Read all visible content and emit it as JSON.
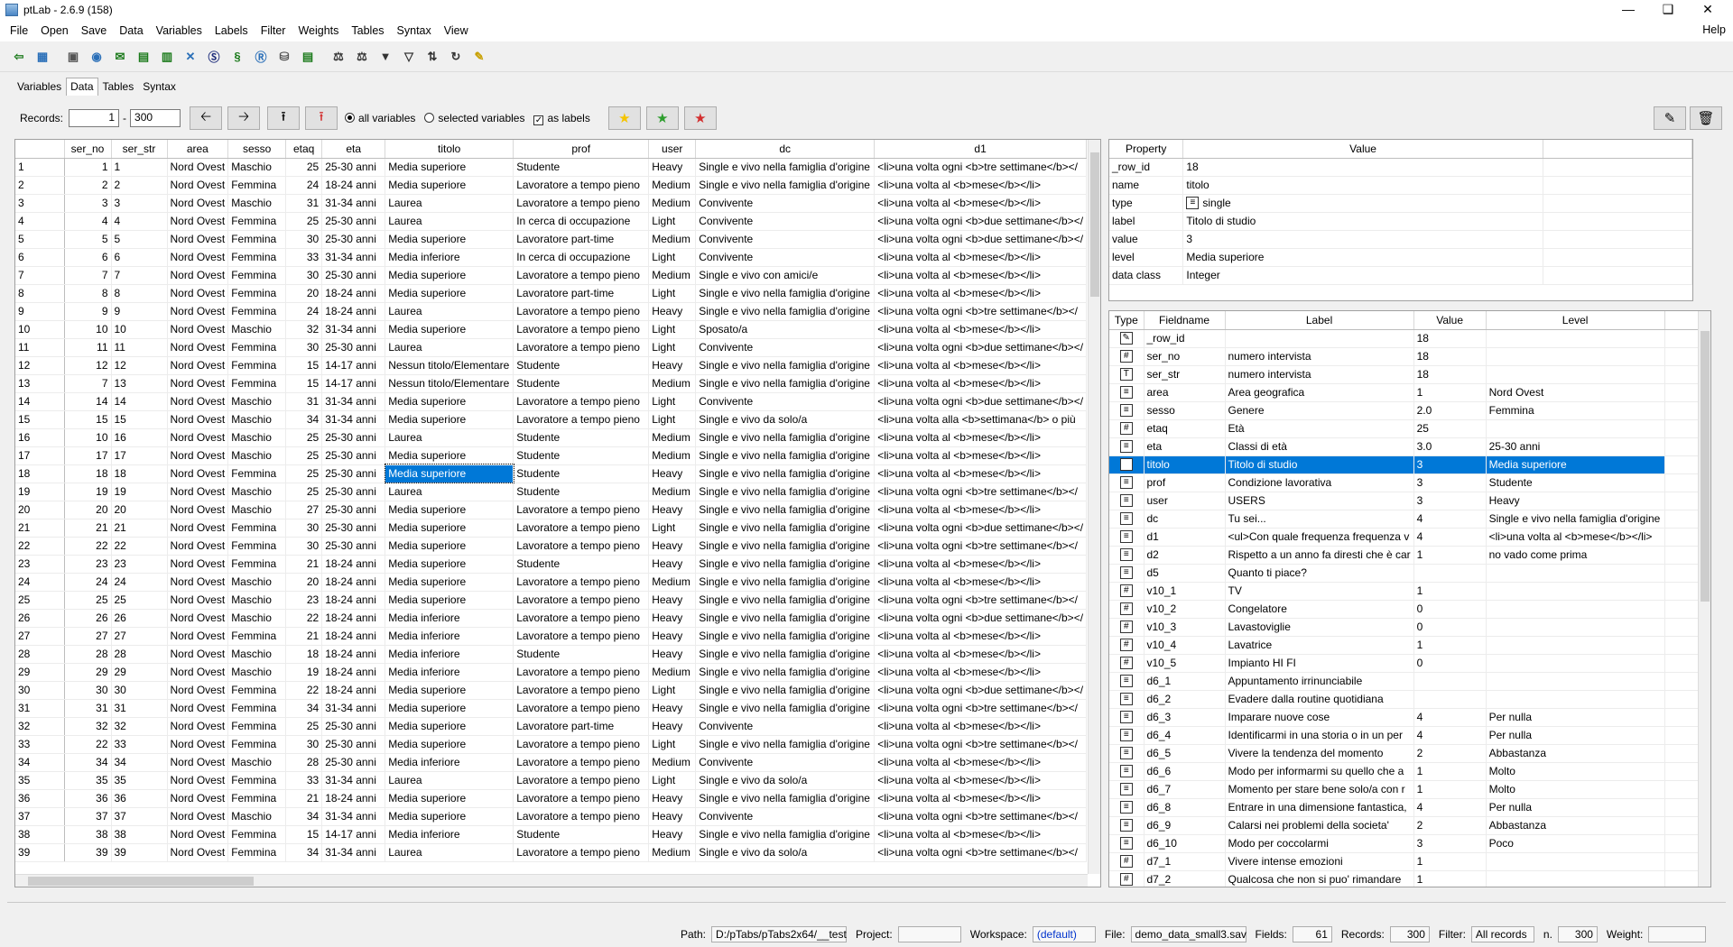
{
  "window": {
    "title": "ptLab - 2.6.9 (158)"
  },
  "menu": [
    "File",
    "Open",
    "Save",
    "Data",
    "Variables",
    "Labels",
    "Filter",
    "Weights",
    "Tables",
    "Syntax",
    "View"
  ],
  "menu_help": "Help",
  "tabs": [
    "Variables",
    "Data",
    "Tables",
    "Syntax"
  ],
  "records": {
    "label": "Records:",
    "from": "1",
    "dash": "-",
    "to": "300"
  },
  "options": {
    "all_variables": "all variables",
    "selected_variables": "selected variables",
    "as_labels": "as labels"
  },
  "toolbar_icons": [
    "exit-icon",
    "grid-icon",
    "layout-icon",
    "globe-icon",
    "spss-icon",
    "excel-icon",
    "csv-icon",
    "sas-icon",
    "stata-icon",
    "s-icon",
    "r-icon",
    "database-icon",
    "export-icon",
    "weight-icon",
    "weight2-icon",
    "filter-icon",
    "filter-clear-icon",
    "sort-icon",
    "refresh-icon",
    "key-icon"
  ],
  "data_columns": [
    "ser_no",
    "ser_str",
    "area",
    "sesso",
    "etaq",
    "eta",
    "titolo",
    "prof",
    "user",
    "dc",
    "d1"
  ],
  "data_rows": [
    [
      "1",
      "1",
      "1",
      "Nord Ovest",
      "Maschio",
      "25",
      "25-30 anni",
      "Media superiore",
      "Studente",
      "Heavy",
      "Single e vivo nella famiglia d'origine",
      "<li>una volta ogni <b>tre settimane</b></"
    ],
    [
      "2",
      "2",
      "2",
      "Nord Ovest",
      "Femmina",
      "24",
      "18-24 anni",
      "Media superiore",
      "Lavoratore a tempo pieno",
      "Medium",
      "Single e vivo nella famiglia d'origine",
      "<li>una volta al <b>mese</b></li>"
    ],
    [
      "3",
      "3",
      "3",
      "Nord Ovest",
      "Maschio",
      "31",
      "31-34 anni",
      "Laurea",
      "Lavoratore a tempo pieno",
      "Medium",
      "Convivente",
      "<li>una volta al <b>mese</b></li>"
    ],
    [
      "4",
      "4",
      "4",
      "Nord Ovest",
      "Femmina",
      "25",
      "25-30 anni",
      "Laurea",
      "In cerca di occupazione",
      "Light",
      "Convivente",
      "<li>una volta ogni <b>due settimane</b></"
    ],
    [
      "5",
      "5",
      "5",
      "Nord Ovest",
      "Femmina",
      "30",
      "25-30 anni",
      "Media superiore",
      "Lavoratore part-time",
      "Medium",
      "Convivente",
      "<li>una volta ogni <b>due settimane</b></"
    ],
    [
      "6",
      "6",
      "6",
      "Nord Ovest",
      "Femmina",
      "33",
      "31-34 anni",
      "Media inferiore",
      "In cerca di occupazione",
      "Light",
      "Convivente",
      "<li>una volta al <b>mese</b></li>"
    ],
    [
      "7",
      "7",
      "7",
      "Nord Ovest",
      "Femmina",
      "30",
      "25-30 anni",
      "Media superiore",
      "Lavoratore a tempo pieno",
      "Medium",
      "Single e vivo con amici/e",
      "<li>una volta al <b>mese</b></li>"
    ],
    [
      "8",
      "8",
      "8",
      "Nord Ovest",
      "Femmina",
      "20",
      "18-24 anni",
      "Media superiore",
      "Lavoratore part-time",
      "Light",
      "Single e vivo nella famiglia d'origine",
      "<li>una volta al <b>mese</b></li>"
    ],
    [
      "9",
      "9",
      "9",
      "Nord Ovest",
      "Femmina",
      "24",
      "18-24 anni",
      "Laurea",
      "Lavoratore a tempo pieno",
      "Heavy",
      "Single e vivo nella famiglia d'origine",
      "<li>una volta ogni <b>tre settimane</b></"
    ],
    [
      "10",
      "10",
      "10",
      "Nord Ovest",
      "Maschio",
      "32",
      "31-34 anni",
      "Media superiore",
      "Lavoratore a tempo pieno",
      "Light",
      "Sposato/a",
      "<li>una volta al <b>mese</b></li>"
    ],
    [
      "11",
      "11",
      "11",
      "Nord Ovest",
      "Femmina",
      "30",
      "25-30 anni",
      "Laurea",
      "Lavoratore a tempo pieno",
      "Light",
      "Convivente",
      "<li>una volta ogni <b>due settimane</b></"
    ],
    [
      "12",
      "12",
      "12",
      "Nord Ovest",
      "Femmina",
      "15",
      "14-17 anni",
      "Nessun titolo/Elementare",
      "Studente",
      "Heavy",
      "Single e vivo nella famiglia d'origine",
      "<li>una volta al <b>mese</b></li>"
    ],
    [
      "13",
      "7",
      "13",
      "Nord Ovest",
      "Femmina",
      "15",
      "14-17 anni",
      "Nessun titolo/Elementare",
      "Studente",
      "Medium",
      "Single e vivo nella famiglia d'origine",
      "<li>una volta al <b>mese</b></li>"
    ],
    [
      "14",
      "14",
      "14",
      "Nord Ovest",
      "Maschio",
      "31",
      "31-34 anni",
      "Media superiore",
      "Lavoratore a tempo pieno",
      "Light",
      "Convivente",
      "<li>una volta ogni <b>due settimane</b></"
    ],
    [
      "15",
      "15",
      "15",
      "Nord Ovest",
      "Maschio",
      "34",
      "31-34 anni",
      "Media superiore",
      "Lavoratore a tempo pieno",
      "Light",
      "Single e vivo da solo/a",
      "<li>una volta alla <b>settimana</b> o più"
    ],
    [
      "16",
      "10",
      "16",
      "Nord Ovest",
      "Maschio",
      "25",
      "25-30 anni",
      "Laurea",
      "Studente",
      "Medium",
      "Single e vivo nella famiglia d'origine",
      "<li>una volta al <b>mese</b></li>"
    ],
    [
      "17",
      "17",
      "17",
      "Nord Ovest",
      "Maschio",
      "25",
      "25-30 anni",
      "Media superiore",
      "Studente",
      "Medium",
      "Single e vivo nella famiglia d'origine",
      "<li>una volta al <b>mese</b></li>"
    ],
    [
      "18",
      "18",
      "18",
      "Nord Ovest",
      "Femmina",
      "25",
      "25-30 anni",
      "Media superiore",
      "Studente",
      "Heavy",
      "Single e vivo nella famiglia d'origine",
      "<li>una volta al <b>mese</b></li>"
    ],
    [
      "19",
      "19",
      "19",
      "Nord Ovest",
      "Maschio",
      "25",
      "25-30 anni",
      "Laurea",
      "Studente",
      "Medium",
      "Single e vivo nella famiglia d'origine",
      "<li>una volta ogni <b>tre settimane</b></"
    ],
    [
      "20",
      "20",
      "20",
      "Nord Ovest",
      "Maschio",
      "27",
      "25-30 anni",
      "Media superiore",
      "Lavoratore a tempo pieno",
      "Heavy",
      "Single e vivo nella famiglia d'origine",
      "<li>una volta al <b>mese</b></li>"
    ],
    [
      "21",
      "21",
      "21",
      "Nord Ovest",
      "Femmina",
      "30",
      "25-30 anni",
      "Media superiore",
      "Lavoratore a tempo pieno",
      "Light",
      "Single e vivo nella famiglia d'origine",
      "<li>una volta ogni <b>due settimane</b></"
    ],
    [
      "22",
      "22",
      "22",
      "Nord Ovest",
      "Femmina",
      "30",
      "25-30 anni",
      "Media superiore",
      "Lavoratore a tempo pieno",
      "Heavy",
      "Single e vivo nella famiglia d'origine",
      "<li>una volta ogni <b>tre settimane</b></"
    ],
    [
      "23",
      "23",
      "23",
      "Nord Ovest",
      "Femmina",
      "21",
      "18-24 anni",
      "Media superiore",
      "Studente",
      "Heavy",
      "Single e vivo nella famiglia d'origine",
      "<li>una volta al <b>mese</b></li>"
    ],
    [
      "24",
      "24",
      "24",
      "Nord Ovest",
      "Maschio",
      "20",
      "18-24 anni",
      "Media superiore",
      "Lavoratore a tempo pieno",
      "Medium",
      "Single e vivo nella famiglia d'origine",
      "<li>una volta al <b>mese</b></li>"
    ],
    [
      "25",
      "25",
      "25",
      "Nord Ovest",
      "Maschio",
      "23",
      "18-24 anni",
      "Media superiore",
      "Lavoratore a tempo pieno",
      "Heavy",
      "Single e vivo nella famiglia d'origine",
      "<li>una volta ogni <b>tre settimane</b></"
    ],
    [
      "26",
      "26",
      "26",
      "Nord Ovest",
      "Maschio",
      "22",
      "18-24 anni",
      "Media inferiore",
      "Lavoratore a tempo pieno",
      "Heavy",
      "Single e vivo nella famiglia d'origine",
      "<li>una volta ogni <b>due settimane</b></"
    ],
    [
      "27",
      "27",
      "27",
      "Nord Ovest",
      "Femmina",
      "21",
      "18-24 anni",
      "Media inferiore",
      "Lavoratore a tempo pieno",
      "Heavy",
      "Single e vivo nella famiglia d'origine",
      "<li>una volta al <b>mese</b></li>"
    ],
    [
      "28",
      "28",
      "28",
      "Nord Ovest",
      "Maschio",
      "18",
      "18-24 anni",
      "Media inferiore",
      "Studente",
      "Heavy",
      "Single e vivo nella famiglia d'origine",
      "<li>una volta al <b>mese</b></li>"
    ],
    [
      "29",
      "29",
      "29",
      "Nord Ovest",
      "Maschio",
      "19",
      "18-24 anni",
      "Media inferiore",
      "Lavoratore a tempo pieno",
      "Medium",
      "Single e vivo nella famiglia d'origine",
      "<li>una volta al <b>mese</b></li>"
    ],
    [
      "30",
      "30",
      "30",
      "Nord Ovest",
      "Femmina",
      "22",
      "18-24 anni",
      "Media superiore",
      "Lavoratore a tempo pieno",
      "Light",
      "Single e vivo nella famiglia d'origine",
      "<li>una volta ogni <b>due settimane</b></"
    ],
    [
      "31",
      "31",
      "31",
      "Nord Ovest",
      "Femmina",
      "34",
      "31-34 anni",
      "Media superiore",
      "Lavoratore a tempo pieno",
      "Heavy",
      "Single e vivo nella famiglia d'origine",
      "<li>una volta ogni <b>tre settimane</b></"
    ],
    [
      "32",
      "32",
      "32",
      "Nord Ovest",
      "Femmina",
      "25",
      "25-30 anni",
      "Media superiore",
      "Lavoratore part-time",
      "Heavy",
      "Convivente",
      "<li>una volta al <b>mese</b></li>"
    ],
    [
      "33",
      "22",
      "33",
      "Nord Ovest",
      "Femmina",
      "30",
      "25-30 anni",
      "Media superiore",
      "Lavoratore a tempo pieno",
      "Light",
      "Single e vivo nella famiglia d'origine",
      "<li>una volta ogni <b>tre settimane</b></"
    ],
    [
      "34",
      "34",
      "34",
      "Nord Ovest",
      "Maschio",
      "28",
      "25-30 anni",
      "Media inferiore",
      "Lavoratore a tempo pieno",
      "Medium",
      "Convivente",
      "<li>una volta al <b>mese</b></li>"
    ],
    [
      "35",
      "35",
      "35",
      "Nord Ovest",
      "Femmina",
      "33",
      "31-34 anni",
      "Laurea",
      "Lavoratore a tempo pieno",
      "Light",
      "Single e vivo da solo/a",
      "<li>una volta al <b>mese</b></li>"
    ],
    [
      "36",
      "36",
      "36",
      "Nord Ovest",
      "Femmina",
      "21",
      "18-24 anni",
      "Media superiore",
      "Lavoratore a tempo pieno",
      "Heavy",
      "Single e vivo nella famiglia d'origine",
      "<li>una volta al <b>mese</b></li>"
    ],
    [
      "37",
      "37",
      "37",
      "Nord Ovest",
      "Maschio",
      "34",
      "31-34 anni",
      "Media superiore",
      "Lavoratore a tempo pieno",
      "Heavy",
      "Convivente",
      "<li>una volta ogni <b>tre settimane</b></"
    ],
    [
      "38",
      "38",
      "38",
      "Nord Ovest",
      "Femmina",
      "15",
      "14-17 anni",
      "Media inferiore",
      "Studente",
      "Heavy",
      "Single e vivo nella famiglia d'origine",
      "<li>una volta al <b>mese</b></li>"
    ],
    [
      "39",
      "39",
      "39",
      "Nord Ovest",
      "Femmina",
      "34",
      "31-34 anni",
      "Laurea",
      "Lavoratore a tempo pieno",
      "Medium",
      "Single e vivo da solo/a",
      "<li>una volta ogni <b>tre settimane</b></"
    ]
  ],
  "selected_row": "18",
  "props": {
    "headers": [
      "Property",
      "Value"
    ],
    "rows": [
      [
        "_row_id",
        "18"
      ],
      [
        "name",
        "titolo"
      ],
      [
        "type",
        "single"
      ],
      [
        "label",
        "Titolo di studio"
      ],
      [
        "value",
        "3"
      ],
      [
        "level",
        "Media superiore"
      ],
      [
        "data class",
        "Integer"
      ]
    ]
  },
  "vars": {
    "headers": [
      "Type",
      "Fieldname",
      "Label",
      "Value",
      "Level"
    ],
    "rows": [
      [
        "id",
        "_row_id",
        "",
        "18",
        ""
      ],
      [
        "#",
        "ser_no",
        "numero intervista",
        "18",
        ""
      ],
      [
        "T",
        "ser_str",
        "numero intervista",
        "18",
        ""
      ],
      [
        "list",
        "area",
        "Area geografica",
        "1",
        "Nord Ovest"
      ],
      [
        "list",
        "sesso",
        "Genere",
        "2.0",
        "Femmina"
      ],
      [
        "#",
        "etaq",
        "Età",
        "25",
        ""
      ],
      [
        "list",
        "eta",
        "Classi di età",
        "3.0",
        "25-30 anni"
      ],
      [
        "list",
        "titolo",
        "Titolo di studio",
        "3",
        "Media superiore"
      ],
      [
        "list",
        "prof",
        "Condizione lavorativa",
        "3",
        "Studente"
      ],
      [
        "list",
        "user",
        "USERS",
        "3",
        "Heavy"
      ],
      [
        "list",
        "dc",
        "Tu sei...",
        "4",
        "Single e vivo nella famiglia d'origine"
      ],
      [
        "list",
        "d1",
        "<ul>Con quale frequenza frequenza v",
        "4",
        "<li>una volta al <b>mese</b></li>"
      ],
      [
        "list",
        "d2",
        "Rispetto a un anno fa diresti che è car",
        "1",
        "no vado come prima"
      ],
      [
        "list",
        "d5",
        "Quanto ti piace?",
        "",
        ""
      ],
      [
        "#",
        "v10_1",
        "TV",
        "1",
        ""
      ],
      [
        "#",
        "v10_2",
        "Congelatore",
        "0",
        ""
      ],
      [
        "#",
        "v10_3",
        "Lavastoviglie",
        "0",
        ""
      ],
      [
        "#",
        "v10_4",
        "Lavatrice",
        "1",
        ""
      ],
      [
        "#",
        "v10_5",
        "Impianto HI FI",
        "0",
        ""
      ],
      [
        "list",
        "d6_1",
        "Appuntamento irrinunciabile",
        "",
        ""
      ],
      [
        "list",
        "d6_2",
        "Evadere dalla routine quotidiana",
        "",
        ""
      ],
      [
        "list",
        "d6_3",
        "Imparare nuove cose",
        "4",
        "Per nulla"
      ],
      [
        "list",
        "d6_4",
        "Identificarmi in una storia o in un per",
        "4",
        "Per nulla"
      ],
      [
        "list",
        "d6_5",
        "Vivere la tendenza del momento",
        "2",
        "Abbastanza"
      ],
      [
        "list",
        "d6_6",
        "Modo per informarmi su quello che a",
        "1",
        "Molto"
      ],
      [
        "list",
        "d6_7",
        "Momento per stare bene solo/a con r",
        "1",
        "Molto"
      ],
      [
        "list",
        "d6_8",
        "Entrare in una dimensione fantastica,",
        "4",
        "Per nulla"
      ],
      [
        "list",
        "d6_9",
        "Calarsi nei problemi della societa'",
        "2",
        "Abbastanza"
      ],
      [
        "list",
        "d6_10",
        "Modo per coccolarmi",
        "3",
        "Poco"
      ],
      [
        "#",
        "d7_1",
        "Vivere intense emozioni",
        "1",
        ""
      ],
      [
        "#",
        "d7_2",
        "Qualcosa che non si puo' rimandare",
        "1",
        ""
      ]
    ]
  },
  "selected_var": "titolo",
  "status": {
    "path_label": "Path:",
    "path": "D:/pTabs/pTabs2x64/__test",
    "project_label": "Project:",
    "project": "",
    "workspace_label": "Workspace:",
    "workspace": "(default)",
    "file_label": "File:",
    "file": "demo_data_small3.sav",
    "fields_label": "Fields:",
    "fields": "61",
    "records_label": "Records:",
    "records": "300",
    "filter_label": "Filter:",
    "filter": "All records",
    "n_label": "n.",
    "n": "300",
    "weight_label": "Weight:",
    "weight": ""
  },
  "colors": {
    "selection": "#0078d7",
    "accent_red": "#d32f2f",
    "star_yellow": "#f5c400",
    "star_green": "#2e9e2e"
  }
}
